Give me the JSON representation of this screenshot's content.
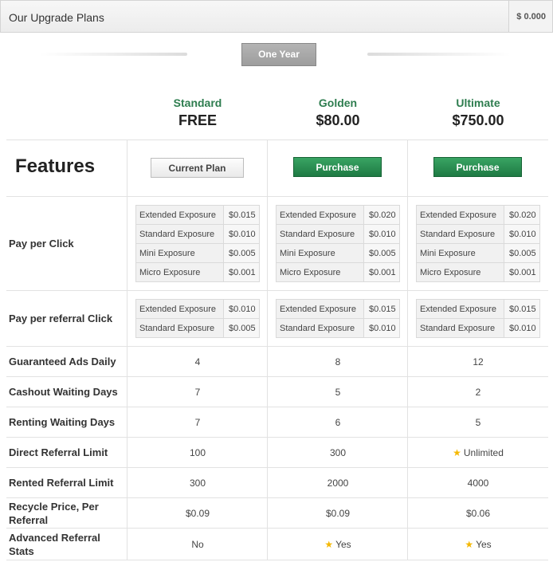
{
  "header": {
    "title": "Our Upgrade Plans",
    "balance": "$ 0.000"
  },
  "period": {
    "label": "One Year"
  },
  "features_title": "Features",
  "plans": [
    {
      "name": "Standard",
      "price": "FREE",
      "button": "Current Plan"
    },
    {
      "name": "Golden",
      "price": "$80.00",
      "button": "Purchase"
    },
    {
      "name": "Ultimate",
      "price": "$750.00",
      "button": "Purchase"
    }
  ],
  "ppc": {
    "label": "Pay per Click",
    "names": [
      "Extended Exposure",
      "Standard Exposure",
      "Mini Exposure",
      "Micro Exposure"
    ],
    "values": [
      [
        "$0.015",
        "$0.010",
        "$0.005",
        "$0.001"
      ],
      [
        "$0.020",
        "$0.010",
        "$0.005",
        "$0.001"
      ],
      [
        "$0.020",
        "$0.010",
        "$0.005",
        "$0.001"
      ]
    ]
  },
  "pprc": {
    "label": "Pay per referral Click",
    "names": [
      "Extended Exposure",
      "Standard Exposure"
    ],
    "values": [
      [
        "$0.010",
        "$0.005"
      ],
      [
        "$0.015",
        "$0.010"
      ],
      [
        "$0.015",
        "$0.010"
      ]
    ]
  },
  "rows": [
    {
      "label": "Guaranteed Ads Daily",
      "values": [
        "4",
        "8",
        "12"
      ]
    },
    {
      "label": "Cashout Waiting Days",
      "values": [
        "7",
        "5",
        "2"
      ]
    },
    {
      "label": "Renting Waiting Days",
      "values": [
        "7",
        "6",
        "5"
      ]
    },
    {
      "label": "Direct Referral Limit",
      "values": [
        "100",
        "300",
        "Unlimited"
      ]
    },
    {
      "label": "Rented Referral Limit",
      "values": [
        "300",
        "2000",
        "4000"
      ]
    },
    {
      "label": "Recycle Price, Per Referral",
      "values": [
        "$0.09",
        "$0.09",
        "$0.06"
      ]
    },
    {
      "label": "Advanced Referral Stats",
      "values": [
        "No",
        "Yes",
        "Yes"
      ]
    }
  ],
  "icons": {
    "star": "star-icon"
  },
  "colors": {
    "plan_name": "#2e7d4f",
    "purchase_button": "#2a8f53",
    "star": "#f5b800"
  }
}
